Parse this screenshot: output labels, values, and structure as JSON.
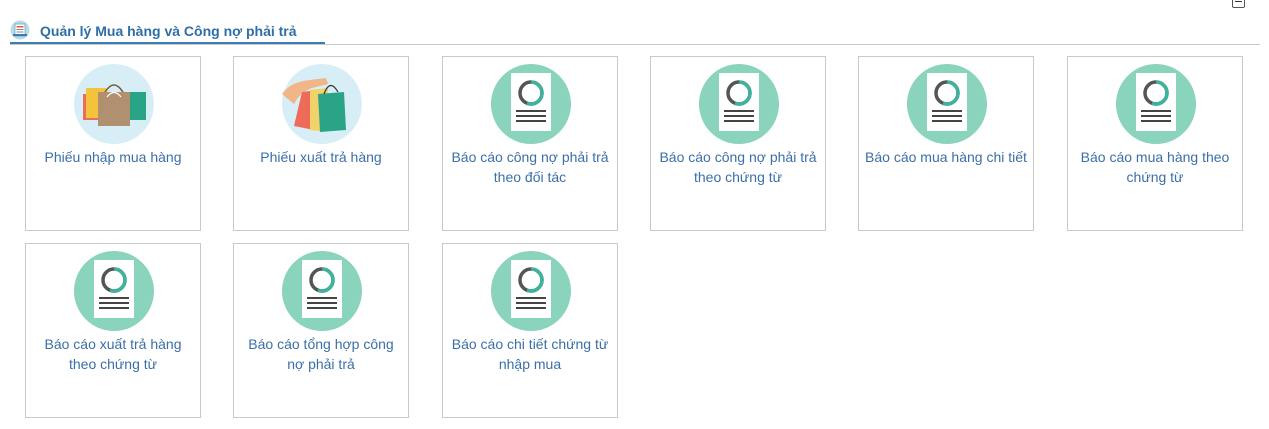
{
  "header": {
    "title": "Quản lý Mua hàng và Công nợ phải trả",
    "icon": "cart-doc-icon",
    "accent": "#2f6ea6"
  },
  "colors": {
    "doc_circle": "#8ad3bc",
    "bag_circle": "#d7eef6",
    "link_text": "#3b6fa8"
  },
  "tiles": [
    {
      "label": "Phiếu nhập mua hàng",
      "icon": "shopping-bags-icon"
    },
    {
      "label": "Phiếu xuất trả hàng",
      "icon": "hand-bags-icon"
    },
    {
      "label": "Báo cáo công nợ phải trả theo đối tác",
      "icon": "report-icon"
    },
    {
      "label": "Báo cáo công nợ phải trả theo chứng từ",
      "icon": "report-icon"
    },
    {
      "label": "Báo cáo mua hàng chi tiết",
      "icon": "report-icon"
    },
    {
      "label": "Báo cáo mua hàng theo chứng từ",
      "icon": "report-icon"
    },
    {
      "label": "Báo cáo xuất trả hàng theo chứng từ",
      "icon": "report-icon"
    },
    {
      "label": "Báo cáo tổng hợp công nợ phải trả",
      "icon": "report-icon"
    },
    {
      "label": "Báo cáo chi tiết chứng từ nhập mua",
      "icon": "report-icon"
    }
  ]
}
